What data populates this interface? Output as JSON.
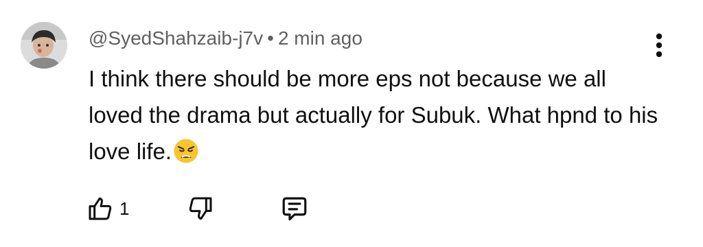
{
  "comment": {
    "author": "@SyedShahzaib-j7v",
    "separator": "•",
    "time": "2 min ago",
    "text": "I think there should be more eps not because we all loved the drama but actually for Subuk. What hpnd to his love life.",
    "emoji": "weary-face"
  },
  "actions": {
    "like_count": "1",
    "like_icon": "thumb-up-icon",
    "dislike_icon": "thumb-down-icon",
    "reply_icon": "comment-reply-icon",
    "menu_icon": "more-vert-icon"
  }
}
